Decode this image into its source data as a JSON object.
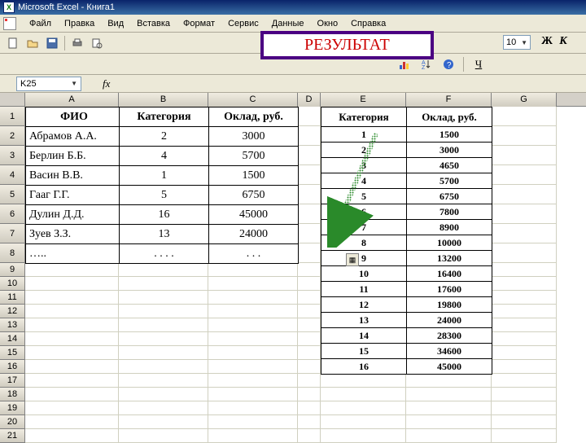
{
  "titlebar": {
    "app": "Microsoft Excel",
    "doc": "Книга1"
  },
  "menu": {
    "file": "Файл",
    "edit": "Правка",
    "view": "Вид",
    "insert": "Вставка",
    "format": "Формат",
    "tools": "Сервис",
    "data": "Данные",
    "window": "Окно",
    "help": "Справка"
  },
  "badge": {
    "text": "РЕЗУЛЬТАТ"
  },
  "font": {
    "size": "10",
    "bold": "Ж",
    "italic": "К"
  },
  "namebox": {
    "ref": "K25"
  },
  "fx_label": "fx",
  "columns": [
    "A",
    "B",
    "C",
    "D",
    "E",
    "F",
    "G"
  ],
  "rownums": [
    "1",
    "2",
    "3",
    "4",
    "5",
    "6",
    "7",
    "8",
    "9",
    "10",
    "11",
    "12",
    "13",
    "14",
    "15",
    "16",
    "17",
    "18",
    "19",
    "20",
    "21"
  ],
  "table1": {
    "headers": [
      "ФИО",
      "Категория",
      "Оклад, руб."
    ],
    "rows": [
      [
        "Абрамов А.А.",
        "2",
        "3000"
      ],
      [
        "Берлин Б.Б.",
        "4",
        "5700"
      ],
      [
        "Васин В.В.",
        "1",
        "1500"
      ],
      [
        "Гааг Г.Г.",
        "5",
        "6750"
      ],
      [
        "Дулин Д.Д.",
        "16",
        "45000"
      ],
      [
        "Зуев З.З.",
        "13",
        "24000"
      ],
      [
        "…..",
        ". . . .",
        ". . ."
      ]
    ]
  },
  "table2": {
    "headers": [
      "Категория",
      "Оклад, руб."
    ],
    "rows": [
      [
        "1",
        "1500"
      ],
      [
        "2",
        "3000"
      ],
      [
        "3",
        "4650"
      ],
      [
        "4",
        "5700"
      ],
      [
        "5",
        "6750"
      ],
      [
        "6",
        "7800"
      ],
      [
        "7",
        "8900"
      ],
      [
        "8",
        "10000"
      ],
      [
        "9",
        "13200"
      ],
      [
        "10",
        "16400"
      ],
      [
        "11",
        "17600"
      ],
      [
        "12",
        "19800"
      ],
      [
        "13",
        "24000"
      ],
      [
        "14",
        "28300"
      ],
      [
        "15",
        "34600"
      ],
      [
        "16",
        "45000"
      ]
    ]
  }
}
